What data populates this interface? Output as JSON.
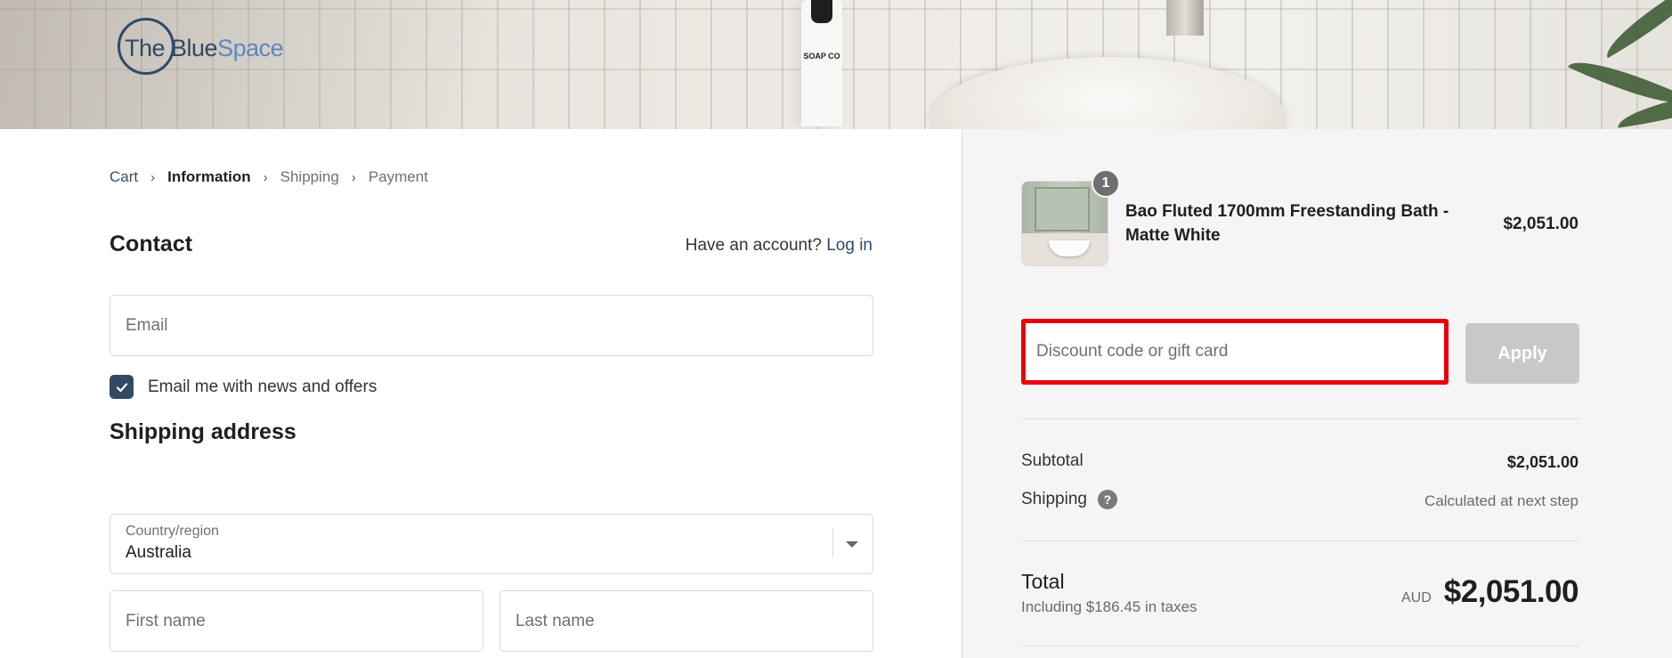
{
  "brand": {
    "logo_part1": "The Blue",
    "logo_part2": "Space",
    "bottle_label": "SOAP CO"
  },
  "breadcrumb": {
    "cart": "Cart",
    "information": "Information",
    "shipping": "Shipping",
    "payment": "Payment",
    "separator": "›"
  },
  "contact": {
    "heading": "Contact",
    "account_prompt": "Have an account?",
    "login": "Log in",
    "email_placeholder": "Email",
    "newsletter_label": "Email me with news and offers",
    "newsletter_checked": true
  },
  "shipping_address": {
    "heading": "Shipping address",
    "country_label": "Country/region",
    "country_value": "Australia",
    "first_name_placeholder": "First name",
    "last_name_placeholder": "Last name"
  },
  "order": {
    "item": {
      "quantity": "1",
      "name": "Bao Fluted 1700mm Freestanding Bath - Matte White",
      "price": "$2,051.00"
    },
    "discount_placeholder": "Discount code or gift card",
    "apply_label": "Apply",
    "subtotal_label": "Subtotal",
    "subtotal_value": "$2,051.00",
    "shipping_label": "Shipping",
    "shipping_help": "?",
    "shipping_value": "Calculated at next step",
    "total_label": "Total",
    "tax_note": "Including $186.45 in taxes",
    "currency": "AUD",
    "total_value": "$2,051.00"
  },
  "colors": {
    "brand_navy": "#2e4a66",
    "brand_blue": "#5c89b8",
    "highlight_red": "#e8000e",
    "checkbox_fill": "#314a63"
  }
}
